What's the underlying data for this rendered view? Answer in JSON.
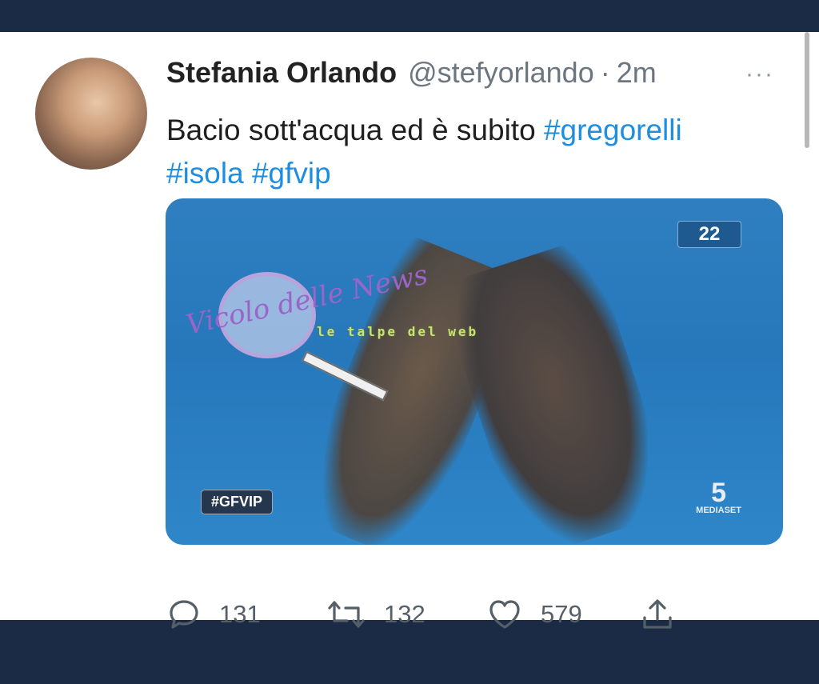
{
  "tweet": {
    "author_name": "Stefania Orlando",
    "handle": "@stefyorlando",
    "separator": "·",
    "time": "2m",
    "more": "···",
    "text_plain": "Bacio sott'acqua ed è subito",
    "hashtags": [
      "#gregorelli",
      "#isola",
      "#gfvip"
    ]
  },
  "media": {
    "overlay_badge": "22",
    "show_tag": "#GFVIP",
    "channel_logo": "5",
    "channel_name": "MEDIASET",
    "watermark_1": "Vicolo delle News",
    "watermark_2": "le talpe del web"
  },
  "actions": {
    "replies": "131",
    "retweets": "132",
    "likes": "579"
  },
  "icons": {
    "reply": "reply-icon",
    "retweet": "retweet-icon",
    "like": "heart-icon",
    "share": "share-icon",
    "more": "more-icon"
  },
  "colors": {
    "accent": "#1d8ee0",
    "background": "#1b2a45",
    "card": "#ffffff",
    "muted": "#6b7680"
  }
}
